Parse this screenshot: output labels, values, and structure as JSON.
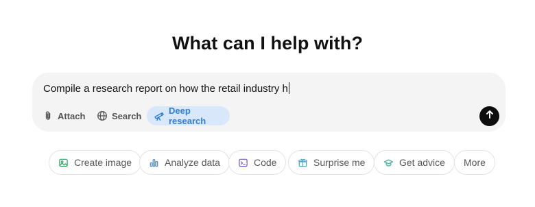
{
  "heading": "What can I help with?",
  "composer": {
    "input_value": "Compile a research report on how the retail industry h",
    "tools": {
      "attach_label": "Attach",
      "search_label": "Search",
      "deep_research_label": "Deep research"
    }
  },
  "suggestions": {
    "create_image": "Create image",
    "analyze_data": "Analyze data",
    "code": "Code",
    "surprise_me": "Surprise me",
    "get_advice": "Get advice",
    "more": "More"
  },
  "colors": {
    "accent": "#2f7ed8",
    "deep_research_bg": "#d8e8fa",
    "send_button": "#0d0d0d",
    "composer_bg": "#f4f4f4"
  },
  "icons": [
    "paperclip-icon",
    "globe-icon",
    "telescope-icon",
    "arrow-up-icon",
    "image-icon",
    "bar-chart-icon",
    "code-icon",
    "gift-icon",
    "graduation-cap-icon"
  ]
}
